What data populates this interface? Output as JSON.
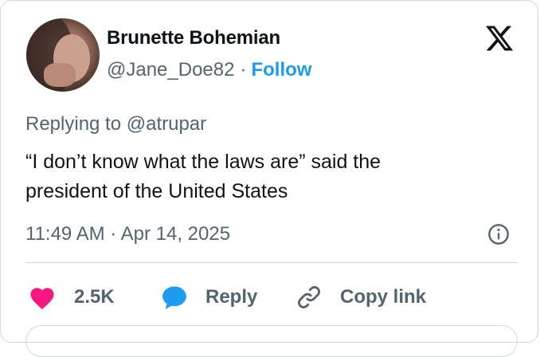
{
  "author": {
    "display_name": "Brunette Bohemian",
    "handle": "@Jane_Doe82",
    "separator": "·",
    "follow_label": "Follow"
  },
  "tweet": {
    "replying_to": "Replying to @atrupar",
    "text_line1": "“I don’t know what the laws are” said the",
    "text_line2": "president of the United States",
    "timestamp": "11:49 AM · Apr 14, 2025"
  },
  "actions": {
    "like_count": "2.5K",
    "reply_label": "Reply",
    "copy_link_label": "Copy link"
  },
  "icons": {
    "logo": "x-logo-icon",
    "info": "info-icon",
    "like": "heart-icon",
    "reply": "speech-bubble-icon",
    "copy": "link-icon"
  },
  "colors": {
    "accent": "#1d9bf0",
    "like": "#f91880",
    "secondary_text": "#536471",
    "primary_text": "#0f1419",
    "border": "#cfd9de"
  }
}
